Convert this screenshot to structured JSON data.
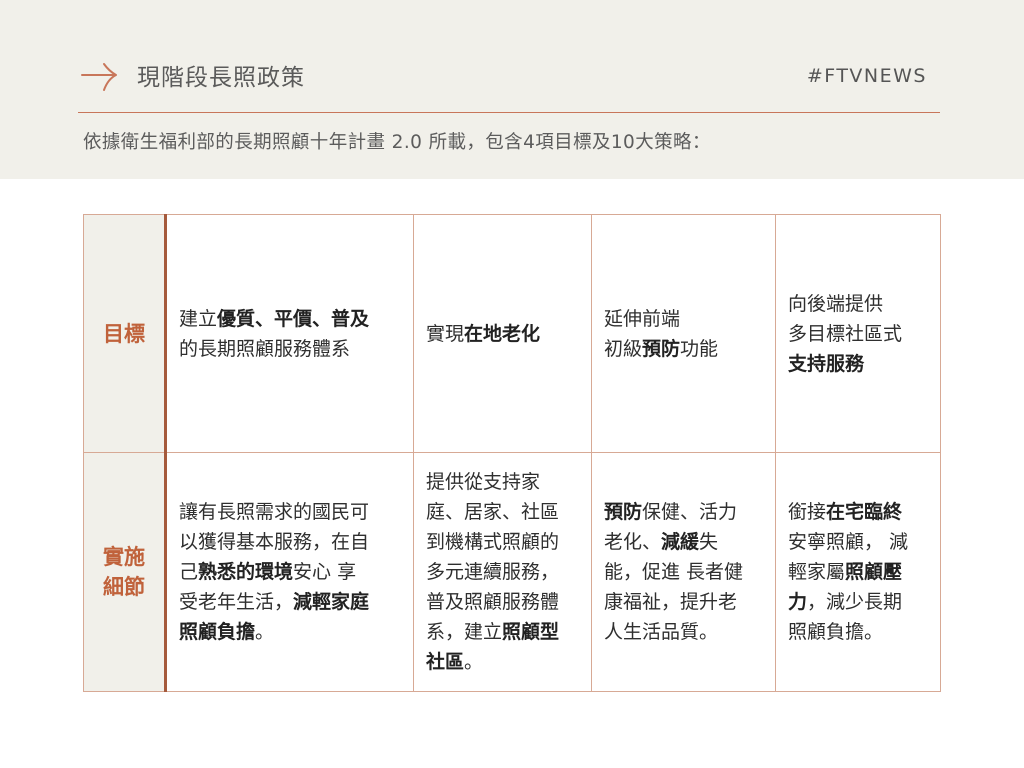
{
  "header": {
    "title": "現階段長照政策",
    "brand": "#FTVNEWS",
    "subtitle": "依據衛生福利部的長期照顧十年計畫 2.0 所載，包含4項目標及10大策略：",
    "accent_color": "#c8765a"
  },
  "table": {
    "row_labels": {
      "goals": "目標",
      "details": "實施細節"
    },
    "goals": [
      {
        "parts": [
          {
            "t": "建立"
          },
          {
            "t": "優質、平價、普及",
            "b": true
          },
          {
            "t": "\n的長期照顧服務體系"
          }
        ]
      },
      {
        "parts": [
          {
            "t": "實現"
          },
          {
            "t": "在地老化",
            "b": true
          }
        ]
      },
      {
        "parts": [
          {
            "t": "延伸前端\n初級"
          },
          {
            "t": "預防",
            "b": true
          },
          {
            "t": "功能"
          }
        ]
      },
      {
        "parts": [
          {
            "t": "向後端提供\n多目標社區式\n"
          },
          {
            "t": "支持服務",
            "b": true
          }
        ]
      }
    ],
    "details": [
      {
        "parts": [
          {
            "t": "讓有長照需求的國民可\n以獲得基本服務，在自\n己"
          },
          {
            "t": "熟悉的環境",
            "b": true
          },
          {
            "t": "安心 享\n受老年生活，"
          },
          {
            "t": "減輕家庭\n照顧負擔",
            "b": true
          },
          {
            "t": "。"
          }
        ]
      },
      {
        "parts": [
          {
            "t": "提供從支持家\n庭、居家、社區\n到機構式照顧的\n多元連續服務，\n普及照顧服務體\n系，建立"
          },
          {
            "t": "照顧型\n社區",
            "b": true
          },
          {
            "t": "。"
          }
        ]
      },
      {
        "parts": [
          {
            "t": "預防",
            "b": true
          },
          {
            "t": "保健、活力\n老化、"
          },
          {
            "t": "減緩",
            "b": true
          },
          {
            "t": "失\n能，促進 長者健\n康福祉，提升老\n人生活品質。"
          }
        ]
      },
      {
        "parts": [
          {
            "t": "銜接"
          },
          {
            "t": "在宅臨終",
            "b": true
          },
          {
            "t": "\n安寧照顧， 減\n輕家屬"
          },
          {
            "t": "照顧壓\n力",
            "b": true
          },
          {
            "t": "，減少長期\n照顧負擔。"
          }
        ]
      }
    ]
  }
}
